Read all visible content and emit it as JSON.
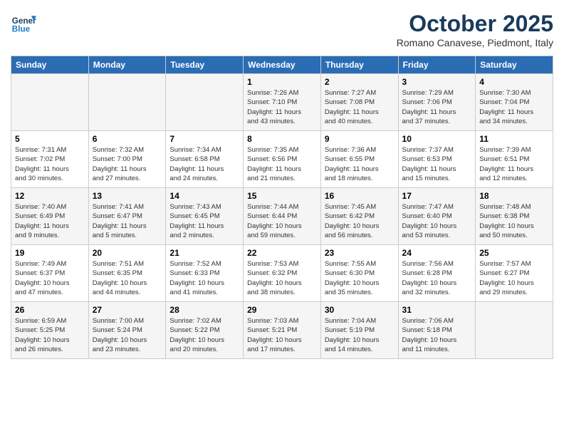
{
  "header": {
    "logo_line1": "General",
    "logo_line2": "Blue",
    "month_title": "October 2025",
    "subtitle": "Romano Canavese, Piedmont, Italy"
  },
  "weekdays": [
    "Sunday",
    "Monday",
    "Tuesday",
    "Wednesday",
    "Thursday",
    "Friday",
    "Saturday"
  ],
  "weeks": [
    [
      {
        "day": "",
        "info": ""
      },
      {
        "day": "",
        "info": ""
      },
      {
        "day": "",
        "info": ""
      },
      {
        "day": "1",
        "info": "Sunrise: 7:26 AM\nSunset: 7:10 PM\nDaylight: 11 hours\nand 43 minutes."
      },
      {
        "day": "2",
        "info": "Sunrise: 7:27 AM\nSunset: 7:08 PM\nDaylight: 11 hours\nand 40 minutes."
      },
      {
        "day": "3",
        "info": "Sunrise: 7:29 AM\nSunset: 7:06 PM\nDaylight: 11 hours\nand 37 minutes."
      },
      {
        "day": "4",
        "info": "Sunrise: 7:30 AM\nSunset: 7:04 PM\nDaylight: 11 hours\nand 34 minutes."
      }
    ],
    [
      {
        "day": "5",
        "info": "Sunrise: 7:31 AM\nSunset: 7:02 PM\nDaylight: 11 hours\nand 30 minutes."
      },
      {
        "day": "6",
        "info": "Sunrise: 7:32 AM\nSunset: 7:00 PM\nDaylight: 11 hours\nand 27 minutes."
      },
      {
        "day": "7",
        "info": "Sunrise: 7:34 AM\nSunset: 6:58 PM\nDaylight: 11 hours\nand 24 minutes."
      },
      {
        "day": "8",
        "info": "Sunrise: 7:35 AM\nSunset: 6:56 PM\nDaylight: 11 hours\nand 21 minutes."
      },
      {
        "day": "9",
        "info": "Sunrise: 7:36 AM\nSunset: 6:55 PM\nDaylight: 11 hours\nand 18 minutes."
      },
      {
        "day": "10",
        "info": "Sunrise: 7:37 AM\nSunset: 6:53 PM\nDaylight: 11 hours\nand 15 minutes."
      },
      {
        "day": "11",
        "info": "Sunrise: 7:39 AM\nSunset: 6:51 PM\nDaylight: 11 hours\nand 12 minutes."
      }
    ],
    [
      {
        "day": "12",
        "info": "Sunrise: 7:40 AM\nSunset: 6:49 PM\nDaylight: 11 hours\nand 9 minutes."
      },
      {
        "day": "13",
        "info": "Sunrise: 7:41 AM\nSunset: 6:47 PM\nDaylight: 11 hours\nand 5 minutes."
      },
      {
        "day": "14",
        "info": "Sunrise: 7:43 AM\nSunset: 6:45 PM\nDaylight: 11 hours\nand 2 minutes."
      },
      {
        "day": "15",
        "info": "Sunrise: 7:44 AM\nSunset: 6:44 PM\nDaylight: 10 hours\nand 59 minutes."
      },
      {
        "day": "16",
        "info": "Sunrise: 7:45 AM\nSunset: 6:42 PM\nDaylight: 10 hours\nand 56 minutes."
      },
      {
        "day": "17",
        "info": "Sunrise: 7:47 AM\nSunset: 6:40 PM\nDaylight: 10 hours\nand 53 minutes."
      },
      {
        "day": "18",
        "info": "Sunrise: 7:48 AM\nSunset: 6:38 PM\nDaylight: 10 hours\nand 50 minutes."
      }
    ],
    [
      {
        "day": "19",
        "info": "Sunrise: 7:49 AM\nSunset: 6:37 PM\nDaylight: 10 hours\nand 47 minutes."
      },
      {
        "day": "20",
        "info": "Sunrise: 7:51 AM\nSunset: 6:35 PM\nDaylight: 10 hours\nand 44 minutes."
      },
      {
        "day": "21",
        "info": "Sunrise: 7:52 AM\nSunset: 6:33 PM\nDaylight: 10 hours\nand 41 minutes."
      },
      {
        "day": "22",
        "info": "Sunrise: 7:53 AM\nSunset: 6:32 PM\nDaylight: 10 hours\nand 38 minutes."
      },
      {
        "day": "23",
        "info": "Sunrise: 7:55 AM\nSunset: 6:30 PM\nDaylight: 10 hours\nand 35 minutes."
      },
      {
        "day": "24",
        "info": "Sunrise: 7:56 AM\nSunset: 6:28 PM\nDaylight: 10 hours\nand 32 minutes."
      },
      {
        "day": "25",
        "info": "Sunrise: 7:57 AM\nSunset: 6:27 PM\nDaylight: 10 hours\nand 29 minutes."
      }
    ],
    [
      {
        "day": "26",
        "info": "Sunrise: 6:59 AM\nSunset: 5:25 PM\nDaylight: 10 hours\nand 26 minutes."
      },
      {
        "day": "27",
        "info": "Sunrise: 7:00 AM\nSunset: 5:24 PM\nDaylight: 10 hours\nand 23 minutes."
      },
      {
        "day": "28",
        "info": "Sunrise: 7:02 AM\nSunset: 5:22 PM\nDaylight: 10 hours\nand 20 minutes."
      },
      {
        "day": "29",
        "info": "Sunrise: 7:03 AM\nSunset: 5:21 PM\nDaylight: 10 hours\nand 17 minutes."
      },
      {
        "day": "30",
        "info": "Sunrise: 7:04 AM\nSunset: 5:19 PM\nDaylight: 10 hours\nand 14 minutes."
      },
      {
        "day": "31",
        "info": "Sunrise: 7:06 AM\nSunset: 5:18 PM\nDaylight: 10 hours\nand 11 minutes."
      },
      {
        "day": "",
        "info": ""
      }
    ]
  ]
}
